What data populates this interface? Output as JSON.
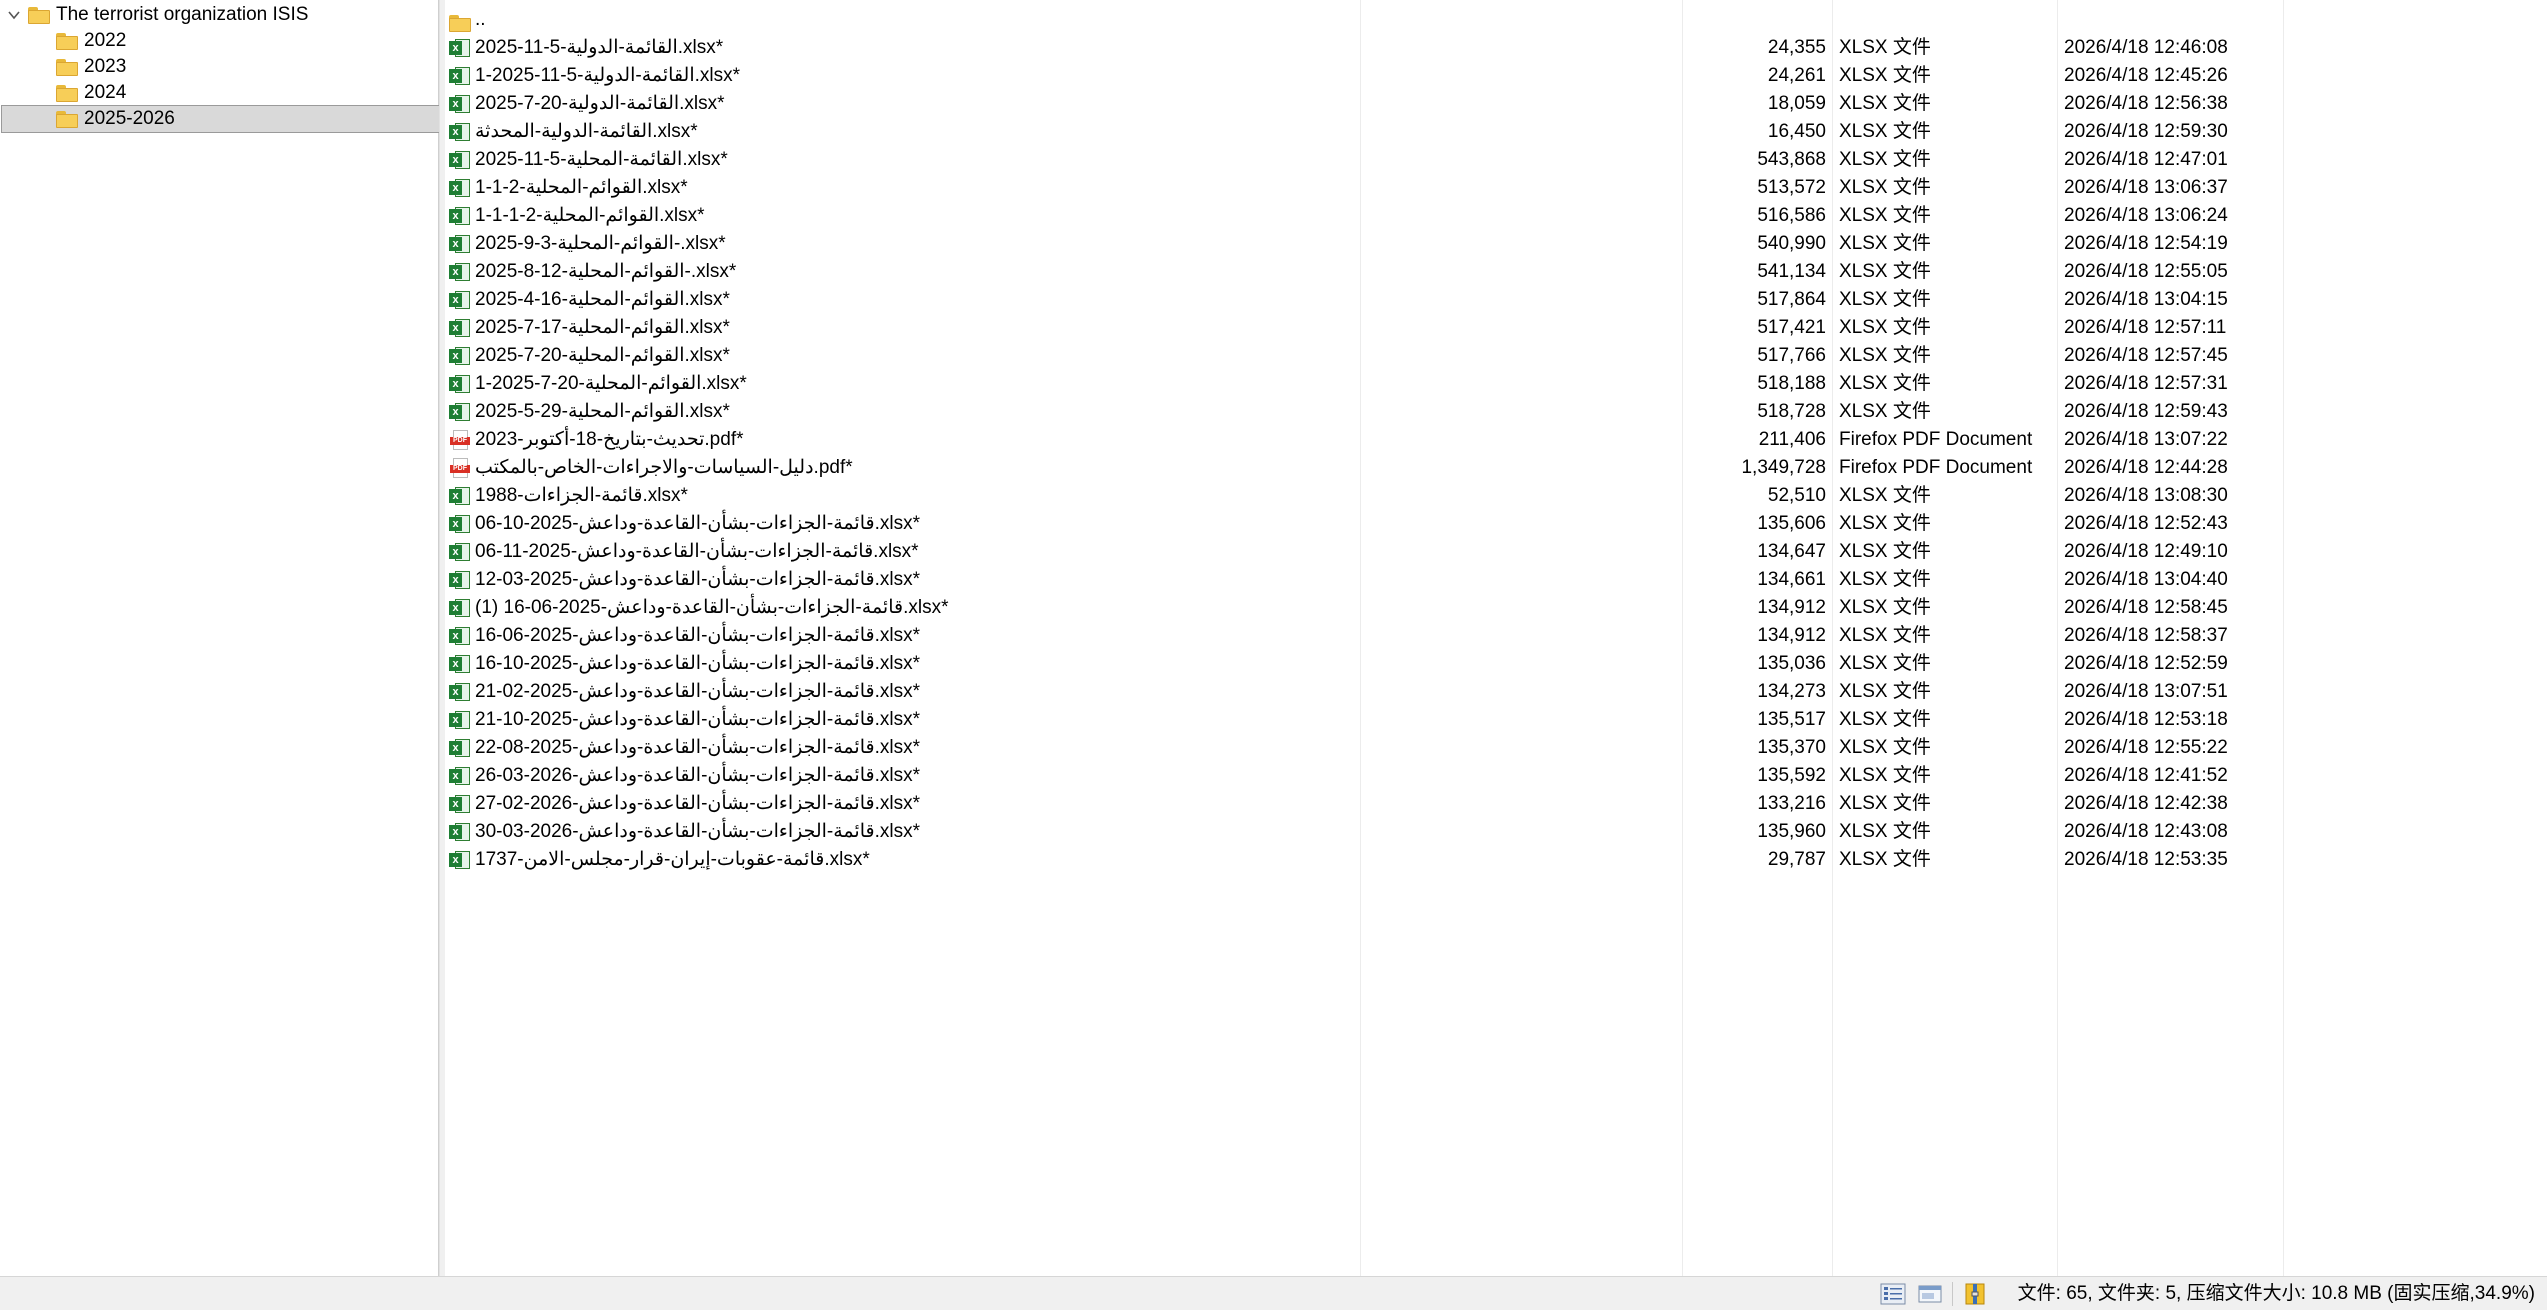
{
  "tree": {
    "root": {
      "label": "The terrorist organization ISIS"
    },
    "folders": [
      {
        "label": "2022",
        "selected": false
      },
      {
        "label": "2023",
        "selected": false
      },
      {
        "label": "2024",
        "selected": false
      },
      {
        "label": "2025-2026",
        "selected": true
      }
    ]
  },
  "list": {
    "parent_label": "..",
    "files": [
      {
        "icon": "excel-icon",
        "name": "2025-11-5-القائمة-الدولية.xlsx*",
        "size": "24,355",
        "type": "XLSX 文件",
        "modified": "2026/4/18 12:46:08"
      },
      {
        "icon": "excel-icon",
        "name": "1-2025-11-5-القائمة-الدولية.xlsx*",
        "size": "24,261",
        "type": "XLSX 文件",
        "modified": "2026/4/18 12:45:26"
      },
      {
        "icon": "excel-icon",
        "name": "2025-7-20-القائمة-الدولية.xlsx*",
        "size": "18,059",
        "type": "XLSX 文件",
        "modified": "2026/4/18 12:56:38"
      },
      {
        "icon": "excel-icon",
        "name": "القائمة-الدولية-المحدثة.xlsx*",
        "size": "16,450",
        "type": "XLSX 文件",
        "modified": "2026/4/18 12:59:30"
      },
      {
        "icon": "excel-icon",
        "name": "2025-11-5-القائمة-المحلية.xlsx*",
        "size": "543,868",
        "type": "XLSX 文件",
        "modified": "2026/4/18 12:47:01"
      },
      {
        "icon": "excel-icon",
        "name": "1-1-2-القوائم-المحلية.xlsx*",
        "size": "513,572",
        "type": "XLSX 文件",
        "modified": "2026/4/18 13:06:37"
      },
      {
        "icon": "excel-icon",
        "name": "1-1-1-2-القوائم-المحلية.xlsx*",
        "size": "516,586",
        "type": "XLSX 文件",
        "modified": "2026/4/18 13:06:24"
      },
      {
        "icon": "excel-icon",
        "name": "2025-9-3-القوائم-المحلية-.xlsx*",
        "size": "540,990",
        "type": "XLSX 文件",
        "modified": "2026/4/18 12:54:19"
      },
      {
        "icon": "excel-icon",
        "name": "2025-8-12-القوائم-المحلية-.xlsx*",
        "size": "541,134",
        "type": "XLSX 文件",
        "modified": "2026/4/18 12:55:05"
      },
      {
        "icon": "excel-icon",
        "name": "2025-4-16-القوائم-المحلية.xlsx*",
        "size": "517,864",
        "type": "XLSX 文件",
        "modified": "2026/4/18 13:04:15"
      },
      {
        "icon": "excel-icon",
        "name": "2025-7-17-القوائم-المحلية.xlsx*",
        "size": "517,421",
        "type": "XLSX 文件",
        "modified": "2026/4/18 12:57:11"
      },
      {
        "icon": "excel-icon",
        "name": "2025-7-20-القوائم-المحلية.xlsx*",
        "size": "517,766",
        "type": "XLSX 文件",
        "modified": "2026/4/18 12:57:45"
      },
      {
        "icon": "excel-icon",
        "name": "1-2025-7-20-القوائم-المحلية.xlsx*",
        "size": "518,188",
        "type": "XLSX 文件",
        "modified": "2026/4/18 12:57:31"
      },
      {
        "icon": "excel-icon",
        "name": "2025-5-29-القوائم-المحلية.xlsx*",
        "size": "518,728",
        "type": "XLSX 文件",
        "modified": "2026/4/18 12:59:43"
      },
      {
        "icon": "pdf-icon",
        "name": "تحديث-بتاريخ-18-أكتوبر-2023.pdf*",
        "size": "211,406",
        "type": "Firefox PDF Document",
        "modified": "2026/4/18 13:07:22"
      },
      {
        "icon": "pdf-icon",
        "name": "دليل-السياسات-والاجراءات-الخاص-بالمكتب.pdf*",
        "size": "1,349,728",
        "type": "Firefox PDF Document",
        "modified": "2026/4/18 12:44:28"
      },
      {
        "icon": "excel-icon",
        "name": "قائمة-الجزاءات-1988.xlsx*",
        "size": "52,510",
        "type": "XLSX 文件",
        "modified": "2026/4/18 13:08:30"
      },
      {
        "icon": "excel-icon",
        "name": "قائمة-الجزاءات-بشأن-القاعدة-وداعش-2025-10-06.xlsx*",
        "size": "135,606",
        "type": "XLSX 文件",
        "modified": "2026/4/18 12:52:43"
      },
      {
        "icon": "excel-icon",
        "name": "قائمة-الجزاءات-بشأن-القاعدة-وداعش-2025-11-06.xlsx*",
        "size": "134,647",
        "type": "XLSX 文件",
        "modified": "2026/4/18 12:49:10"
      },
      {
        "icon": "excel-icon",
        "name": "قائمة-الجزاءات-بشأن-القاعدة-وداعش-2025-03-12.xlsx*",
        "size": "134,661",
        "type": "XLSX 文件",
        "modified": "2026/4/18 13:04:40"
      },
      {
        "icon": "excel-icon",
        "name": "قائمة-الجزاءات-بشأن-القاعدة-وداعش-2025-06-16 (1).xlsx*",
        "size": "134,912",
        "type": "XLSX 文件",
        "modified": "2026/4/18 12:58:45"
      },
      {
        "icon": "excel-icon",
        "name": "قائمة-الجزاءات-بشأن-القاعدة-وداعش-2025-06-16.xlsx*",
        "size": "134,912",
        "type": "XLSX 文件",
        "modified": "2026/4/18 12:58:37"
      },
      {
        "icon": "excel-icon",
        "name": "قائمة-الجزاءات-بشأن-القاعدة-وداعش-2025-10-16.xlsx*",
        "size": "135,036",
        "type": "XLSX 文件",
        "modified": "2026/4/18 12:52:59"
      },
      {
        "icon": "excel-icon",
        "name": "قائمة-الجزاءات-بشأن-القاعدة-وداعش-2025-02-21.xlsx*",
        "size": "134,273",
        "type": "XLSX 文件",
        "modified": "2026/4/18 13:07:51"
      },
      {
        "icon": "excel-icon",
        "name": "قائمة-الجزاءات-بشأن-القاعدة-وداعش-2025-10-21.xlsx*",
        "size": "135,517",
        "type": "XLSX 文件",
        "modified": "2026/4/18 12:53:18"
      },
      {
        "icon": "excel-icon",
        "name": "قائمة-الجزاءات-بشأن-القاعدة-وداعش-2025-08-22.xlsx*",
        "size": "135,370",
        "type": "XLSX 文件",
        "modified": "2026/4/18 12:55:22"
      },
      {
        "icon": "excel-icon",
        "name": "قائمة-الجزاءات-بشأن-القاعدة-وداعش-2026-03-26.xlsx*",
        "size": "135,592",
        "type": "XLSX 文件",
        "modified": "2026/4/18 12:41:52"
      },
      {
        "icon": "excel-icon",
        "name": "قائمة-الجزاءات-بشأن-القاعدة-وداعش-2026-02-27.xlsx*",
        "size": "133,216",
        "type": "XLSX 文件",
        "modified": "2026/4/18 12:42:38"
      },
      {
        "icon": "excel-icon",
        "name": "قائمة-الجزاءات-بشأن-القاعدة-وداعش-2026-03-30.xlsx*",
        "size": "135,960",
        "type": "XLSX 文件",
        "modified": "2026/4/18 12:43:08"
      },
      {
        "icon": "excel-icon",
        "name": "قائمة-عقوبات-إيران-قرار-مجلس-الامن-1737.xlsx*",
        "size": "29,787",
        "type": "XLSX 文件",
        "modified": "2026/4/18 12:53:35"
      }
    ]
  },
  "statusbar": {
    "text": "文件: 65, 文件夹: 5, 压缩文件大小: 10.8 MB (固实压缩,34.9%)"
  },
  "colors": {
    "selection_bg": "#d9d9d9",
    "folder_yellow": "#f7ce58",
    "excel_green": "#1e7e34",
    "pdf_red": "#d93025",
    "statusbar_bg": "#f0f0f0"
  }
}
